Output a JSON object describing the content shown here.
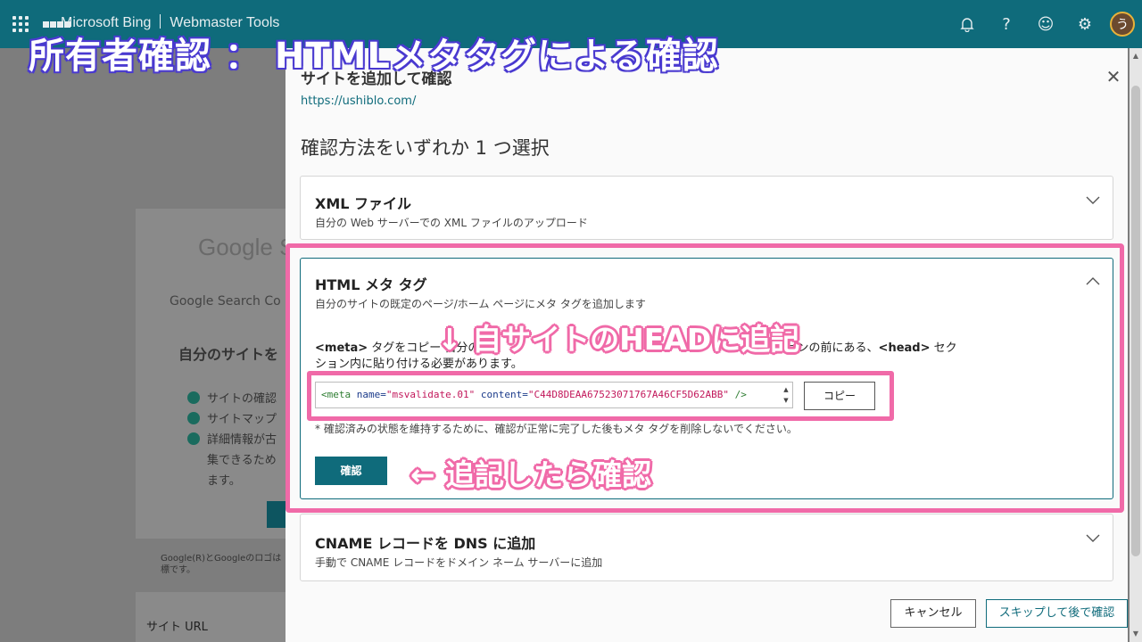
{
  "topbar": {
    "brand_product": "Microsoft Bing",
    "brand_tool": "Webmaster Tools",
    "icons": [
      "waffle-icon",
      "bell-icon",
      "help-icon",
      "smiley-icon",
      "gear-icon"
    ],
    "avatar_initial": "う"
  },
  "background": {
    "google_logo": "Google S",
    "gsc_text": "Google Search Co",
    "heading": "自分のサイトを",
    "list": [
      "サイトの確認",
      "サイトマップ",
      "詳細情報が古",
      "集できるため",
      "ます。"
    ],
    "footer": "Google(R)とGoogleのロゴは 標です。",
    "site_url_label": "サイト URL"
  },
  "dialog": {
    "title": "サイトを追加して確認",
    "url": "https://ushiblo.com/",
    "subtitle": "確認方法をいずれか 1 つ選択",
    "xml": {
      "title": "XML ファイル",
      "desc": "自分の Web サーバーでの XML ファイルのアップロード"
    },
    "html_meta": {
      "title": "HTML メタ タグ",
      "desc": "自分のサイトの既定のページ/ホーム ページにメタ タグを追加します",
      "para_meta": "<meta>",
      "para_1": " タグをコピー  自分の",
      "para_2": " セクションの前にある、",
      "para_head": "<head>",
      "para_3": " セク",
      "para_4": "ション内に貼り付ける必要があります。",
      "code_open": "<meta ",
      "code_name_attr": "name=",
      "code_name_val": "\"msvalidate.01\"",
      "code_content_attr": " content=",
      "code_content_val": "\"C44D8DEAA67523071767A46CF5D62ABB\"",
      "code_close": " />",
      "copy_label": "コピー",
      "note": "* 確認済みの状態を維持するために、確認が正常に完了した後もメタ タグを削除しないでください。",
      "confirm_label": "確認"
    },
    "cname": {
      "title": "CNAME レコードを DNS に追加",
      "desc": "手動で CNAME レコードをドメイン ネーム サーバーに追加"
    },
    "cancel_label": "キャンセル",
    "skip_label": "スキップして後で確認"
  },
  "annotations": {
    "title": "所有者確認 ： HTMLメタタグによる確認",
    "note_head": "↓ 自サイトのHEADに追記",
    "note_confirm": "← 追記したら確認"
  },
  "colors": {
    "topbar": "#0f6b7b",
    "highlight": "#f06aa8",
    "title_outline": "#4a3ad0"
  }
}
